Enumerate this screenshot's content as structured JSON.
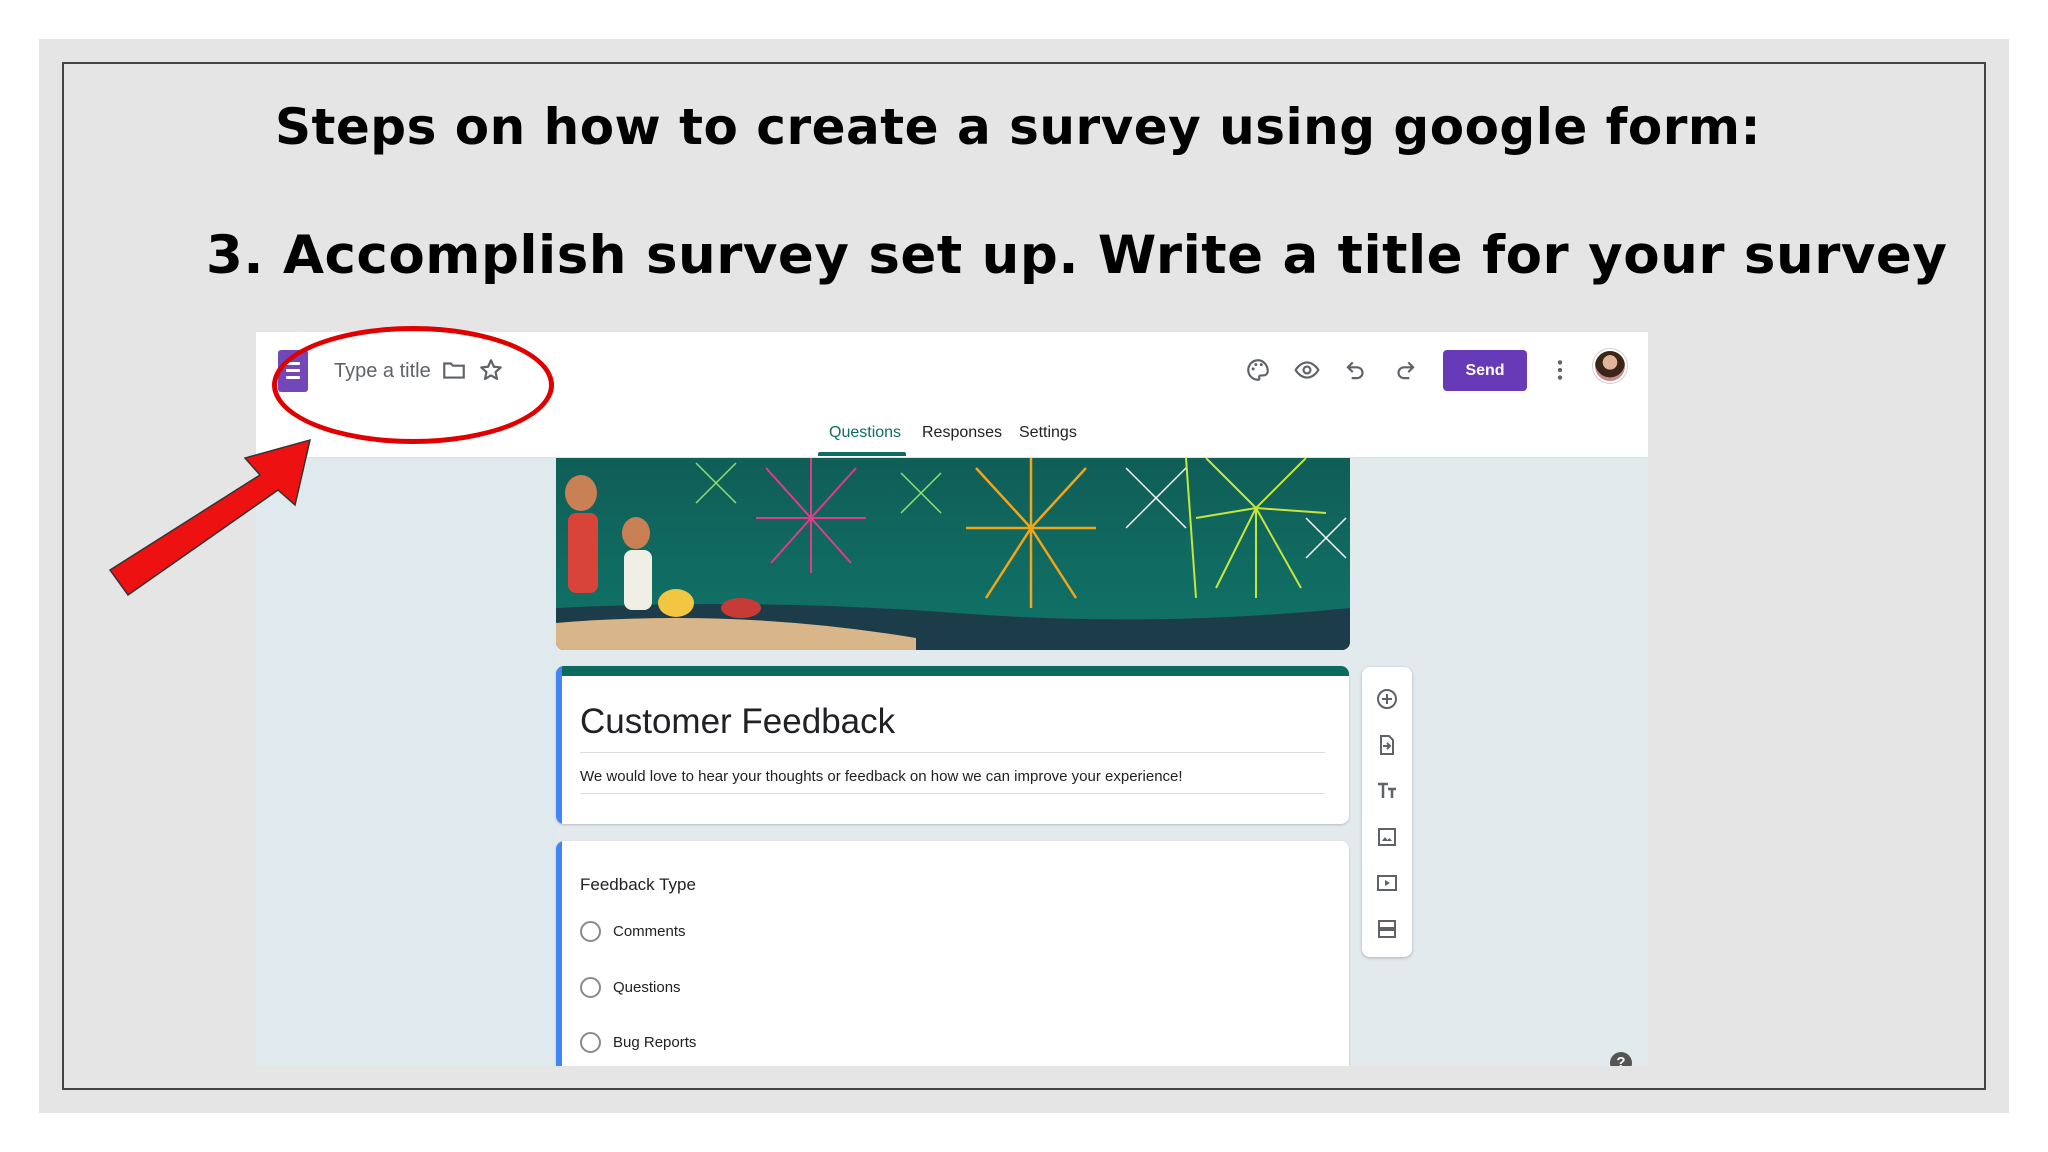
{
  "slide": {
    "title": "Steps on how to create a survey using google form:",
    "subtitle": "3. Accomplish survey set up. Write a title for your survey"
  },
  "forms_header": {
    "title_placeholder": "Type a title",
    "send_label": "Send",
    "icons": [
      "folder-icon",
      "star-icon",
      "palette-icon",
      "preview-icon",
      "undo-icon",
      "redo-icon",
      "more-icon"
    ]
  },
  "tabs": [
    {
      "label": "Questions",
      "active": true
    },
    {
      "label": "Responses",
      "active": false
    },
    {
      "label": "Settings",
      "active": false
    }
  ],
  "form": {
    "title": "Customer Feedback",
    "description": "We would love to hear your thoughts or feedback on how we can improve your experience!"
  },
  "question": {
    "title": "Feedback Type",
    "options": [
      "Comments",
      "Questions",
      "Bug Reports"
    ]
  },
  "toolbar": {
    "icons": [
      "add-question-icon",
      "import-questions-icon",
      "add-title-icon",
      "add-image-icon",
      "add-video-icon",
      "add-section-icon"
    ]
  },
  "colors": {
    "accent": "#673ab7",
    "theme": "#0d6a5f",
    "annotation": "#e00000"
  }
}
